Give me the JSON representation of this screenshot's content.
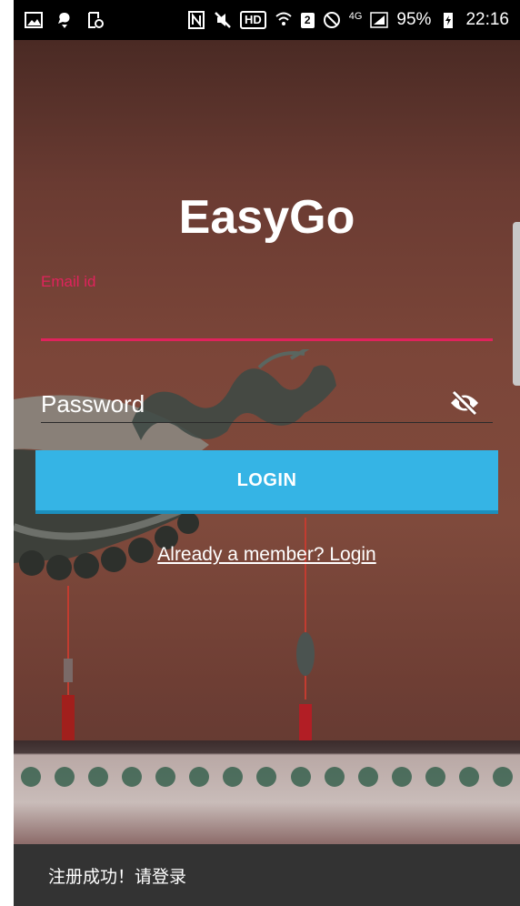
{
  "status_bar": {
    "battery": "95%",
    "time": "22:16",
    "hd_badge": "HD",
    "sim_badge": "2",
    "network": "4G"
  },
  "app": {
    "title": "EasyGo"
  },
  "form": {
    "email_label": "Email id",
    "email_value": "",
    "password_placeholder": "Password",
    "password_value": "",
    "login_label": "LOGIN",
    "member_link": "Already a member? Login"
  },
  "toast": {
    "message": "注册成功！请登录"
  },
  "colors": {
    "accent": "#e0235c",
    "button": "#35b4e5",
    "toast_bg": "#333333",
    "status_bg": "#000000"
  }
}
